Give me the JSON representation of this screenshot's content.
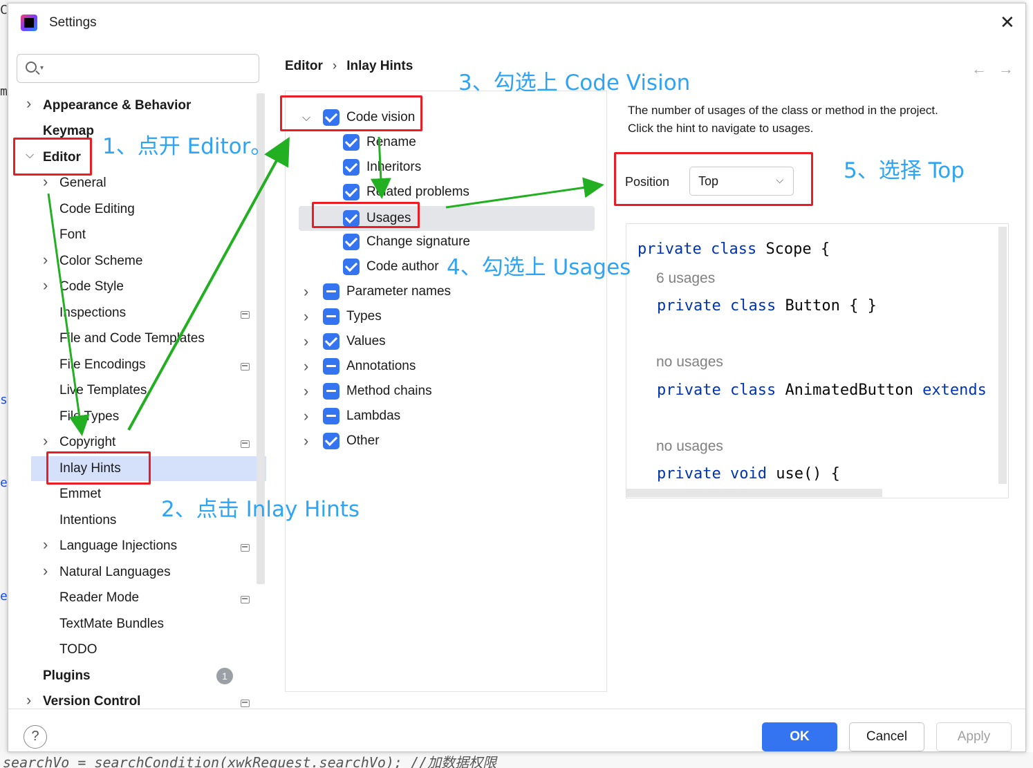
{
  "window": {
    "title": "Settings"
  },
  "search": {
    "placeholder": "",
    "value": ""
  },
  "tree": {
    "items": [
      {
        "label": "Appearance & Behavior",
        "bold": true
      },
      {
        "label": "Keymap",
        "bold": true
      },
      {
        "label": "Editor",
        "bold": true
      },
      {
        "label": "General"
      },
      {
        "label": "Code Editing"
      },
      {
        "label": "Font"
      },
      {
        "label": "Color Scheme"
      },
      {
        "label": "Code Style"
      },
      {
        "label": "Inspections"
      },
      {
        "label": "File and Code Templates"
      },
      {
        "label": "File Encodings"
      },
      {
        "label": "Live Templates"
      },
      {
        "label": "File Types"
      },
      {
        "label": "Copyright"
      },
      {
        "label": "Inlay Hints",
        "selected": true
      },
      {
        "label": "Emmet"
      },
      {
        "label": "Intentions"
      },
      {
        "label": "Language Injections"
      },
      {
        "label": "Natural Languages"
      },
      {
        "label": "Reader Mode"
      },
      {
        "label": "TextMate Bundles"
      },
      {
        "label": "TODO"
      },
      {
        "label": "Plugins",
        "bold": true,
        "badge": "1"
      },
      {
        "label": "Version Control",
        "bold": true
      }
    ]
  },
  "breadcrumb": {
    "parent": "Editor",
    "separator": "›",
    "current": "Inlay Hints"
  },
  "nav": {
    "back": "←",
    "forward": "→"
  },
  "hints": [
    {
      "label": "Code vision",
      "state": "checked",
      "expanded": true
    },
    {
      "label": "Rename",
      "state": "checked"
    },
    {
      "label": "Inheritors",
      "state": "checked"
    },
    {
      "label": "Related problems",
      "state": "checked"
    },
    {
      "label": "Usages",
      "state": "checked",
      "selected": true
    },
    {
      "label": "Change signature",
      "state": "checked"
    },
    {
      "label": "Code author",
      "state": "checked"
    },
    {
      "label": "Parameter names",
      "state": "partial"
    },
    {
      "label": "Types",
      "state": "partial"
    },
    {
      "label": "Values",
      "state": "checked"
    },
    {
      "label": "Annotations",
      "state": "partial"
    },
    {
      "label": "Method chains",
      "state": "partial"
    },
    {
      "label": "Lambdas",
      "state": "partial"
    },
    {
      "label": "Other",
      "state": "checked"
    }
  ],
  "description": {
    "line1": "The number of usages of the class or method in the project.",
    "line2": "Click the hint to navigate to usages."
  },
  "position": {
    "label": "Position",
    "value": "Top"
  },
  "preview": {
    "line1": {
      "kw": "private class",
      "rest": "Scope {"
    },
    "hint1": "6 usages",
    "line2": {
      "kw": "private class",
      "rest": "Button { }"
    },
    "hint2": "no usages",
    "line3": {
      "kw": "private class",
      "rest": "AnimatedButton",
      "kw2": "extends"
    },
    "hint3": "no usages",
    "line4": {
      "kw": "private void",
      "rest": "use() {"
    }
  },
  "footer": {
    "help": "?",
    "ok": "OK",
    "cancel": "Cancel",
    "apply": "Apply"
  },
  "annotations": {
    "step1": "1、点开 Editor。",
    "step2": "2、点击 Inlay Hints",
    "step3": "3、勾选上 Code Vision",
    "step4": "4、勾选上 Usages",
    "step5": "5、选择 Top"
  },
  "colors": {
    "accent": "#3574f0",
    "annotation_text": "#2ea4f4",
    "annotation_box": "#ea1c24",
    "arrow": "#22b022"
  },
  "background": {
    "bottom_code": "searchVo = searchCondition(xwkRequest.searchVo); //加数据权限"
  }
}
